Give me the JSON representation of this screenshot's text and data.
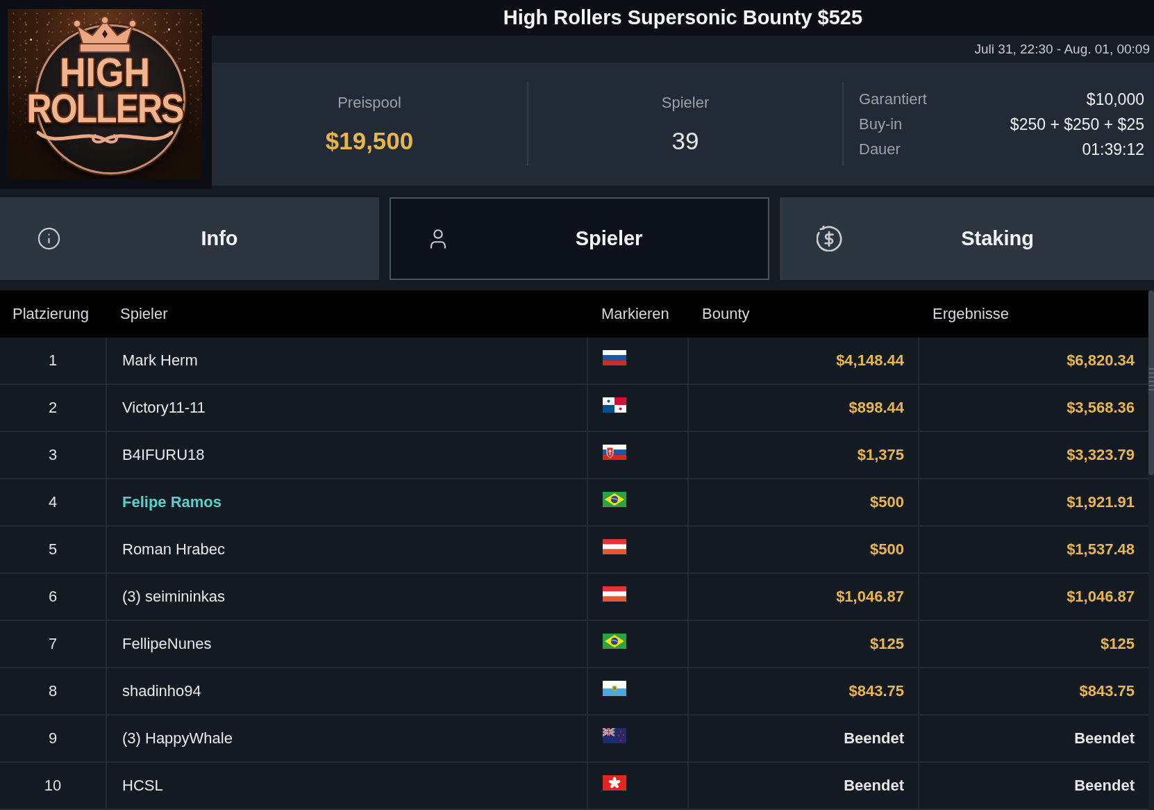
{
  "header": {
    "title": "High Rollers Supersonic Bounty $525",
    "date_range": "Juli 31, 22:30 - Aug. 01, 00:09"
  },
  "logo": {
    "lines": [
      "HIGH",
      "ROLLERS"
    ]
  },
  "stats": {
    "prize_pool": {
      "label": "Preispool",
      "value": "$19,500"
    },
    "players": {
      "label": "Spieler",
      "value": "39"
    },
    "details": [
      {
        "label": "Garantiert",
        "value": "$10,000"
      },
      {
        "label": "Buy-in",
        "value": "$250 + $250 + $25"
      },
      {
        "label": "Dauer",
        "value": "01:39:12"
      }
    ]
  },
  "tabs": [
    {
      "kind": "info",
      "label": "Info",
      "selected": false
    },
    {
      "kind": "players",
      "label": "Spieler",
      "selected": true
    },
    {
      "kind": "staking",
      "label": "Staking",
      "selected": false
    }
  ],
  "table": {
    "columns": [
      "Platzierung",
      "Spieler",
      "Markieren",
      "Bounty",
      "Ergebnisse"
    ],
    "rows": [
      {
        "place": "1",
        "player": "Mark Herm",
        "highlighted": false,
        "flag": {
          "kind": "russia"
        },
        "bounty": "$4,148.44",
        "result": "$6,820.34",
        "ended": false
      },
      {
        "place": "2",
        "player": "Victory11-11",
        "highlighted": false,
        "flag": {
          "kind": "panama"
        },
        "bounty": "$898.44",
        "result": "$3,568.36",
        "ended": false
      },
      {
        "place": "3",
        "player": "B4IFURU18",
        "highlighted": false,
        "flag": {
          "kind": "slovakia"
        },
        "bounty": "$1,375",
        "result": "$3,323.79",
        "ended": false
      },
      {
        "place": "4",
        "player": "Felipe Ramos",
        "highlighted": true,
        "flag": {
          "kind": "brazil"
        },
        "bounty": "$500",
        "result": "$1,921.91",
        "ended": false
      },
      {
        "place": "5",
        "player": "Roman Hrabec",
        "highlighted": false,
        "flag": {
          "kind": "austria"
        },
        "bounty": "$500",
        "result": "$1,537.48",
        "ended": false
      },
      {
        "place": "6",
        "player": "(3) seimininkas",
        "highlighted": false,
        "flag": {
          "kind": "austria"
        },
        "bounty": "$1,046.87",
        "result": "$1,046.87",
        "ended": false
      },
      {
        "place": "7",
        "player": "FellipeNunes",
        "highlighted": false,
        "flag": {
          "kind": "brazil"
        },
        "bounty": "$125",
        "result": "$125",
        "ended": false
      },
      {
        "place": "8",
        "player": "shadinho94",
        "highlighted": false,
        "flag": {
          "kind": "san_marino"
        },
        "bounty": "$843.75",
        "result": "$843.75",
        "ended": false
      },
      {
        "place": "9",
        "player": "(3) HappyWhale",
        "highlighted": false,
        "flag": {
          "kind": "new_zealand"
        },
        "bounty": "Beendet",
        "result": "Beendet",
        "ended": true
      },
      {
        "place": "10",
        "player": "HCSL",
        "highlighted": false,
        "flag": {
          "kind": "hong_kong"
        },
        "bounty": "Beendet",
        "result": "Beendet",
        "ended": true
      }
    ]
  }
}
